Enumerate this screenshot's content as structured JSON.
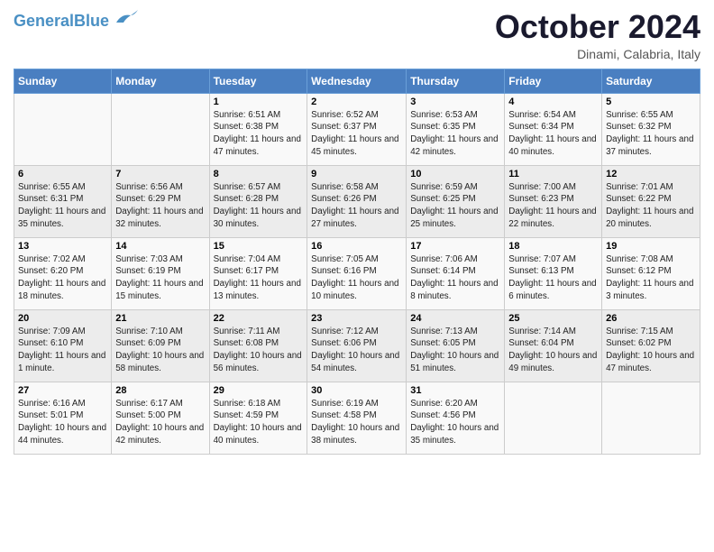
{
  "header": {
    "logo_general": "General",
    "logo_blue": "Blue",
    "month": "October 2024",
    "location": "Dinami, Calabria, Italy"
  },
  "days_of_week": [
    "Sunday",
    "Monday",
    "Tuesday",
    "Wednesday",
    "Thursday",
    "Friday",
    "Saturday"
  ],
  "weeks": [
    [
      {
        "day": "",
        "info": ""
      },
      {
        "day": "",
        "info": ""
      },
      {
        "day": "1",
        "info": "Sunrise: 6:51 AM\nSunset: 6:38 PM\nDaylight: 11 hours and 47 minutes."
      },
      {
        "day": "2",
        "info": "Sunrise: 6:52 AM\nSunset: 6:37 PM\nDaylight: 11 hours and 45 minutes."
      },
      {
        "day": "3",
        "info": "Sunrise: 6:53 AM\nSunset: 6:35 PM\nDaylight: 11 hours and 42 minutes."
      },
      {
        "day": "4",
        "info": "Sunrise: 6:54 AM\nSunset: 6:34 PM\nDaylight: 11 hours and 40 minutes."
      },
      {
        "day": "5",
        "info": "Sunrise: 6:55 AM\nSunset: 6:32 PM\nDaylight: 11 hours and 37 minutes."
      }
    ],
    [
      {
        "day": "6",
        "info": "Sunrise: 6:55 AM\nSunset: 6:31 PM\nDaylight: 11 hours and 35 minutes."
      },
      {
        "day": "7",
        "info": "Sunrise: 6:56 AM\nSunset: 6:29 PM\nDaylight: 11 hours and 32 minutes."
      },
      {
        "day": "8",
        "info": "Sunrise: 6:57 AM\nSunset: 6:28 PM\nDaylight: 11 hours and 30 minutes."
      },
      {
        "day": "9",
        "info": "Sunrise: 6:58 AM\nSunset: 6:26 PM\nDaylight: 11 hours and 27 minutes."
      },
      {
        "day": "10",
        "info": "Sunrise: 6:59 AM\nSunset: 6:25 PM\nDaylight: 11 hours and 25 minutes."
      },
      {
        "day": "11",
        "info": "Sunrise: 7:00 AM\nSunset: 6:23 PM\nDaylight: 11 hours and 22 minutes."
      },
      {
        "day": "12",
        "info": "Sunrise: 7:01 AM\nSunset: 6:22 PM\nDaylight: 11 hours and 20 minutes."
      }
    ],
    [
      {
        "day": "13",
        "info": "Sunrise: 7:02 AM\nSunset: 6:20 PM\nDaylight: 11 hours and 18 minutes."
      },
      {
        "day": "14",
        "info": "Sunrise: 7:03 AM\nSunset: 6:19 PM\nDaylight: 11 hours and 15 minutes."
      },
      {
        "day": "15",
        "info": "Sunrise: 7:04 AM\nSunset: 6:17 PM\nDaylight: 11 hours and 13 minutes."
      },
      {
        "day": "16",
        "info": "Sunrise: 7:05 AM\nSunset: 6:16 PM\nDaylight: 11 hours and 10 minutes."
      },
      {
        "day": "17",
        "info": "Sunrise: 7:06 AM\nSunset: 6:14 PM\nDaylight: 11 hours and 8 minutes."
      },
      {
        "day": "18",
        "info": "Sunrise: 7:07 AM\nSunset: 6:13 PM\nDaylight: 11 hours and 6 minutes."
      },
      {
        "day": "19",
        "info": "Sunrise: 7:08 AM\nSunset: 6:12 PM\nDaylight: 11 hours and 3 minutes."
      }
    ],
    [
      {
        "day": "20",
        "info": "Sunrise: 7:09 AM\nSunset: 6:10 PM\nDaylight: 11 hours and 1 minute."
      },
      {
        "day": "21",
        "info": "Sunrise: 7:10 AM\nSunset: 6:09 PM\nDaylight: 10 hours and 58 minutes."
      },
      {
        "day": "22",
        "info": "Sunrise: 7:11 AM\nSunset: 6:08 PM\nDaylight: 10 hours and 56 minutes."
      },
      {
        "day": "23",
        "info": "Sunrise: 7:12 AM\nSunset: 6:06 PM\nDaylight: 10 hours and 54 minutes."
      },
      {
        "day": "24",
        "info": "Sunrise: 7:13 AM\nSunset: 6:05 PM\nDaylight: 10 hours and 51 minutes."
      },
      {
        "day": "25",
        "info": "Sunrise: 7:14 AM\nSunset: 6:04 PM\nDaylight: 10 hours and 49 minutes."
      },
      {
        "day": "26",
        "info": "Sunrise: 7:15 AM\nSunset: 6:02 PM\nDaylight: 10 hours and 47 minutes."
      }
    ],
    [
      {
        "day": "27",
        "info": "Sunrise: 6:16 AM\nSunset: 5:01 PM\nDaylight: 10 hours and 44 minutes."
      },
      {
        "day": "28",
        "info": "Sunrise: 6:17 AM\nSunset: 5:00 PM\nDaylight: 10 hours and 42 minutes."
      },
      {
        "day": "29",
        "info": "Sunrise: 6:18 AM\nSunset: 4:59 PM\nDaylight: 10 hours and 40 minutes."
      },
      {
        "day": "30",
        "info": "Sunrise: 6:19 AM\nSunset: 4:58 PM\nDaylight: 10 hours and 38 minutes."
      },
      {
        "day": "31",
        "info": "Sunrise: 6:20 AM\nSunset: 4:56 PM\nDaylight: 10 hours and 35 minutes."
      },
      {
        "day": "",
        "info": ""
      },
      {
        "day": "",
        "info": ""
      }
    ]
  ]
}
